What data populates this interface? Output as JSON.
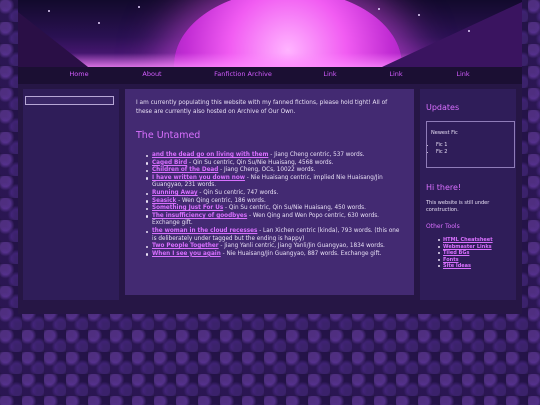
{
  "nav": {
    "items": [
      {
        "label": "Home"
      },
      {
        "label": "About"
      },
      {
        "label": "Fanfiction Archive"
      },
      {
        "label": "Link"
      },
      {
        "label": "Link"
      },
      {
        "label": "Link"
      }
    ]
  },
  "main": {
    "intro": "I am currently populating this website with my fanned fictions, please hold tight! All of these are currently also hosted on Archive of Our Own.",
    "section_title": "The Untamed",
    "fics": [
      {
        "title": "and the dead go on living with them",
        "desc": " - Jiang Cheng centric, 537 words."
      },
      {
        "title": "Caged Bird",
        "desc": " - Qin Su centric, Qin Su/Nie Huaisang, 4568 words."
      },
      {
        "title": "Children of the Dead",
        "desc": " - Jiang Cheng, OCs, 10022 words."
      },
      {
        "title": "I have written you down now",
        "desc": " - Nie Huaisang centric, implied Nie Huaisang/Jin Guangyao, 231 words."
      },
      {
        "title": "Running Away",
        "desc": " - Qin Su centric, 747 words."
      },
      {
        "title": "Seasick",
        "desc": " - Wen Qing centric, 186 words."
      },
      {
        "title": "Something Just For Us",
        "desc": " - Qin Su centric, Qin Su/Nie Huaisang, 450 words."
      },
      {
        "title": "The insufficiency of goodbyes",
        "desc": " - Wen Qing and Wen Popo centric, 630 words. Exchange gift."
      },
      {
        "title": "the woman in the cloud recesses",
        "desc": " - Lan Xichen centric (kinda), 793 words. (this one is deliberately under tagged but the ending is happy)"
      },
      {
        "title": "Two People Together",
        "desc": " - Jiang Yanli centric, Jiang Yanli/Jin Guangyao, 1834 words."
      },
      {
        "title": "When I see you again",
        "desc": " - Nie Huaisang/Jin Guangyao, 887 words. Exchange gift."
      }
    ]
  },
  "right": {
    "updates_heading": "Updates",
    "newest_title": "Newest Fic",
    "newest_items": [
      "Fic 1",
      "Fic 2"
    ],
    "hi_heading": "Hi there!",
    "hi_text": "This website is still under construction.",
    "tools_heading": "Other Tools",
    "tools": [
      "HTML Cheatsheet",
      "Webmaster Links",
      "Tiled BGs",
      "Fonts",
      "Site Ideas"
    ]
  },
  "colors": {
    "accent": "#d970ff",
    "main_bg": "#432a72",
    "sidebar_bg": "#2f1d59",
    "page_bg": "#1c1236"
  },
  "icons": {
    "banner": "purple-sunset-banner-image"
  }
}
